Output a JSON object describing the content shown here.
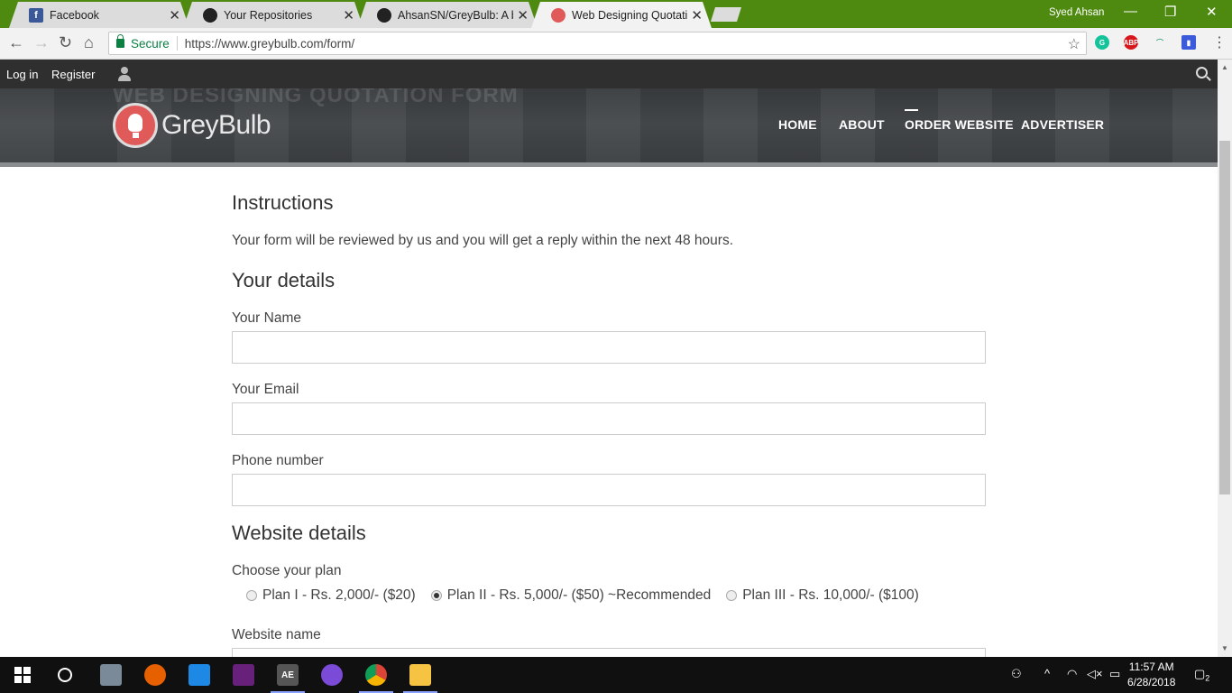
{
  "browser": {
    "tabs": [
      {
        "title": "Facebook",
        "icon": "facebook-icon",
        "color": "#3b5998",
        "glyph": "f"
      },
      {
        "title": "Your Repositories",
        "icon": "github-icon",
        "color": "#222222",
        "glyph": "●"
      },
      {
        "title": "AhsanSN/GreyBulb: A bu",
        "icon": "github-icon",
        "color": "#222222",
        "glyph": "●"
      },
      {
        "title": "Web Designing Quotation",
        "icon": "greybulb-icon",
        "color": "#e05a5a",
        "glyph": "●"
      }
    ],
    "window_user": "Syed Ahsan",
    "secure_label": "Secure",
    "url": "https://www.greybulb.com/form/"
  },
  "site": {
    "topbar": {
      "login": "Log in",
      "register": "Register"
    },
    "hero_text": "WEB DESIGNING QUOTATION FORM",
    "logo_text": "GreyBulb",
    "nav": [
      "HOME",
      "ABOUT",
      "ORDER WEBSITE",
      "ADVERTISER"
    ],
    "active_nav": "ORDER WEBSITE"
  },
  "form": {
    "instructions_heading": "Instructions",
    "instructions_text": "Your form will be reviewed by us and you will get a reply within the next 48 hours.",
    "details_heading": "Your details",
    "name_label": "Your Name",
    "name_value": "",
    "email_label": "Your Email",
    "email_value": "",
    "phone_label": "Phone number",
    "phone_value": "",
    "website_heading": "Website details",
    "plan_label": "Choose your plan",
    "plans": [
      {
        "label": "Plan I - Rs. 2,000/- ($20)",
        "checked": false
      },
      {
        "label": "Plan II - Rs. 5,000/- ($50) ~Recommended",
        "checked": true
      },
      {
        "label": "Plan III - Rs. 10,000/- ($100)",
        "checked": false
      }
    ],
    "website_name_label": "Website name"
  },
  "taskbar": {
    "time": "11:57 AM",
    "date": "6/28/2018",
    "notifications": "2",
    "ae_label": "AE"
  },
  "colors": {
    "tabstrip": "#4f8a10",
    "secure": "#0b8043",
    "topbar": "#2f2f2f"
  }
}
